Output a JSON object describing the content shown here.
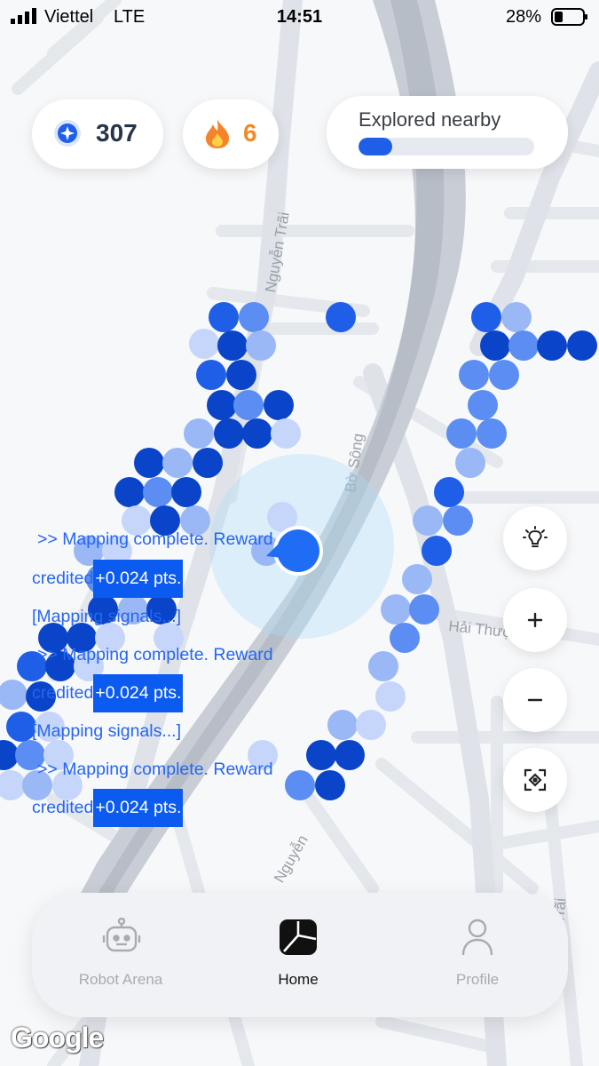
{
  "status_bar": {
    "carrier": "Viettel",
    "network": "LTE",
    "time": "14:51",
    "battery": "28%"
  },
  "stats": {
    "points": "307",
    "points_icon": "sparkle-coin-icon",
    "streak": "6",
    "streak_icon": "flame-icon",
    "explore_label": "Explored nearby",
    "explore_progress": 0.19
  },
  "map": {
    "streets": [
      "Nguyễn Trãi",
      "Bờ Sông",
      "Hải Thượng Lãn",
      "Nguyễn",
      "Trãi"
    ],
    "accent": "#1f5fe8"
  },
  "controls": {
    "hint": "lightbulb-icon",
    "zoom_in": "plus-icon",
    "zoom_out": "minus-icon",
    "recenter": "target-icon"
  },
  "log": {
    "line1": ">> Mapping complete. Reward",
    "line2_prefix": "credited",
    "line2_reward": "+0.024 pts.",
    "line3": "[Mapping signals...]",
    "line4": ">> Mapping complete. Reward",
    "line5_prefix": "credited",
    "line5_reward": "+0.024 pts.",
    "line6": "[Mapping signals...]",
    "line7": ">> Mapping complete. Reward",
    "line8_prefix": "credited",
    "line8_reward": "+0.024 pts."
  },
  "nav": {
    "tabs": [
      {
        "label": "Robot Arena",
        "icon": "robot-icon"
      },
      {
        "label": "Home",
        "icon": "home-logo-icon"
      },
      {
        "label": "Profile",
        "icon": "person-icon"
      }
    ]
  },
  "attribution": "Google"
}
